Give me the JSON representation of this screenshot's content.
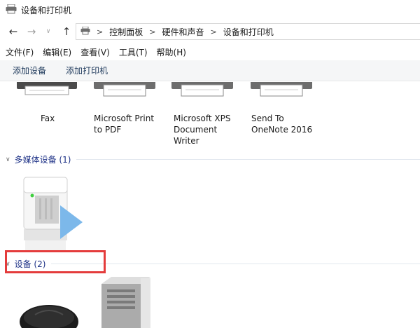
{
  "window": {
    "title": "设备和打印机"
  },
  "navigation": {
    "back_icon": "←",
    "forward_icon": "→",
    "dropdown_icon": "∨",
    "up_icon": "↑",
    "breadcrumb": [
      "控制面板",
      "硬件和声音",
      "设备和打印机"
    ]
  },
  "menu": [
    "文件(F)",
    "编辑(E)",
    "查看(V)",
    "工具(T)",
    "帮助(H)"
  ],
  "commands": {
    "add_device": "添加设备",
    "add_printer": "添加打印机"
  },
  "printers": [
    {
      "label": "Fax"
    },
    {
      "label": "Microsoft Print\nto PDF"
    },
    {
      "label": "Microsoft XPS\nDocument\nWriter"
    },
    {
      "label": "Send To\nOneNote 2016"
    }
  ],
  "groups": {
    "multimedia": {
      "label": "多媒体设备 (1)"
    },
    "devices": {
      "label": "设备 (2)"
    }
  },
  "colors": {
    "group_header": "#1e3287",
    "highlight": "#e43c3c",
    "command_bar": "#f5f6f7",
    "play_accent": "#7cb8ea"
  }
}
